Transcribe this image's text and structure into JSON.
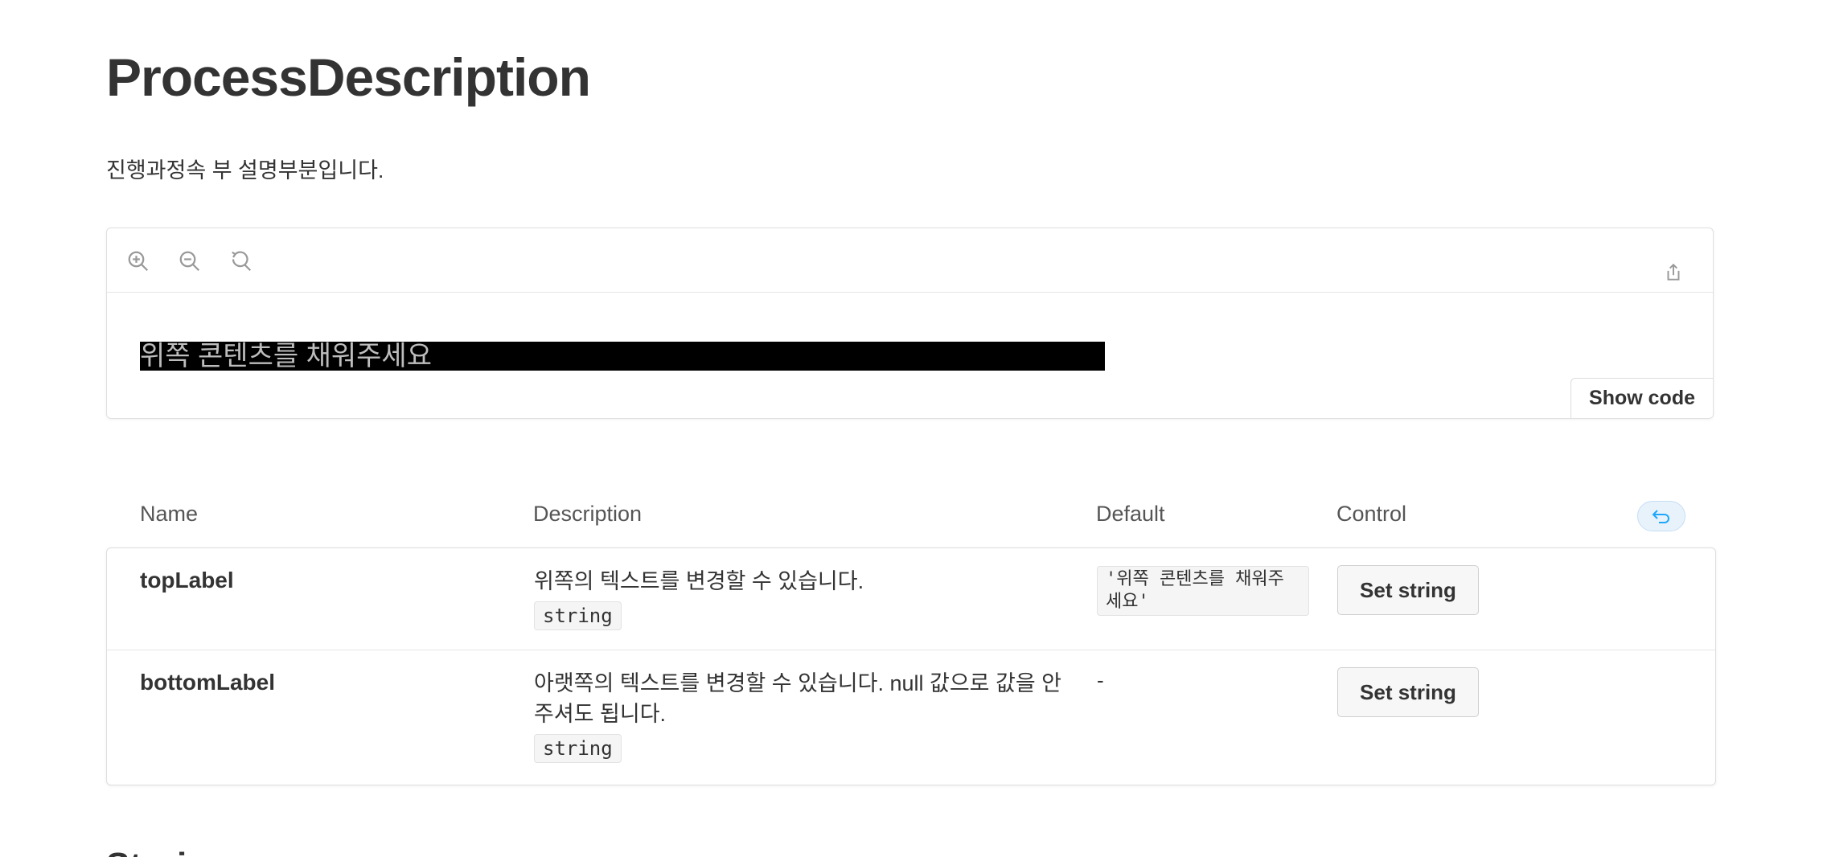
{
  "page": {
    "title": "ProcessDescription",
    "description": "진행과정속 부 설명부분입니다.",
    "next_heading": "Stories"
  },
  "canvas": {
    "toolbar": {
      "zoom_in_icon": "zoom-in-icon",
      "zoom_out_icon": "zoom-out-icon",
      "reset_zoom_icon": "reset-zoom-icon",
      "share_icon": "share-icon"
    },
    "preview_text": "위쪽 콘텐츠를 채워주세요",
    "show_code_label": "Show code"
  },
  "args_table": {
    "headers": {
      "name": "Name",
      "description": "Description",
      "default": "Default",
      "control": "Control"
    },
    "reset_icon": "undo-icon",
    "rows": [
      {
        "name": "topLabel",
        "description": "위쪽의 텍스트를 변경할 수 있습니다.",
        "type": "string",
        "default": "'위쪽 콘텐츠를 채워주세요'",
        "control_label": "Set string"
      },
      {
        "name": "bottomLabel",
        "description": "아랫쪽의 텍스트를 변경할 수 있습니다. null 값으로 값을 안 주셔도 됩니다.",
        "type": "string",
        "default": "-",
        "control_label": "Set string"
      }
    ]
  },
  "colors": {
    "text": "#333333",
    "border": "#e0e0e0",
    "preview_bg": "#000000",
    "preview_text": "#bdbdbd",
    "reset_accent": "#1ea7fd"
  }
}
